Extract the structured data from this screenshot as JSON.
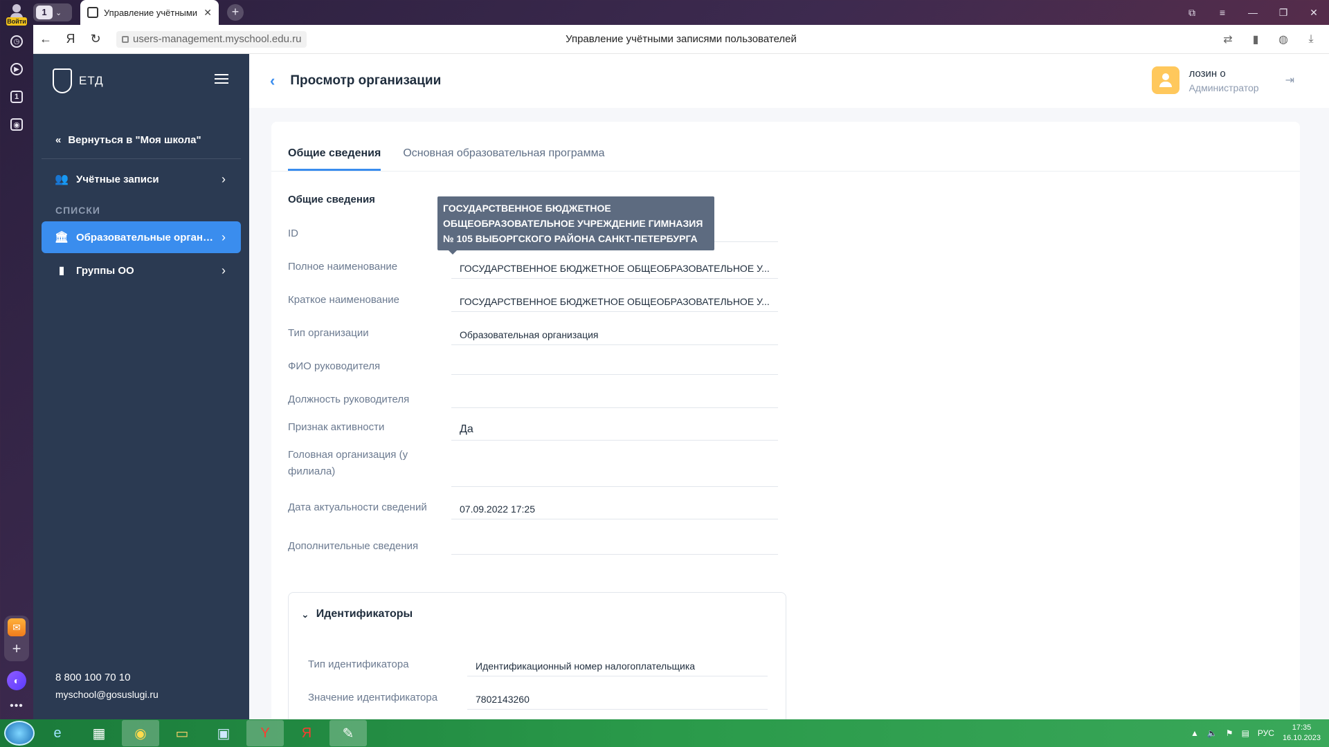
{
  "browser": {
    "tab_count": "1",
    "tab_title": "Управление учётными",
    "url": "users-management.myschool.edu.ru",
    "page_title": "Управление учётными записями пользователей",
    "login_badge": "Войти"
  },
  "sidebar": {
    "logo_text": "ЕТД",
    "back_label": "Вернуться в \"Моя школа\"",
    "items": [
      {
        "label": "Учётные записи"
      }
    ],
    "section_title": "СПИСКИ",
    "list_items": [
      {
        "label": "Образовательные организа..."
      },
      {
        "label": "Группы ОО"
      }
    ],
    "phone": "8 800 100 70 10",
    "email": "myschool@gosuslugi.ru"
  },
  "header": {
    "title": "Просмотр организации",
    "user_name": "лозин о",
    "user_role": "Администратор"
  },
  "tabs": [
    {
      "label": "Общие сведения"
    },
    {
      "label": "Основная образовательная программа"
    }
  ],
  "general": {
    "section_title": "Общие сведения",
    "tooltip": "ГОСУДАРСТВЕННОЕ БЮДЖЕТНОЕ ОБЩЕОБРАЗОВАТЕЛЬНОЕ УЧРЕЖДЕНИЕ ГИМНАЗИЯ № 105 ВЫБОРГСКОГО РАЙОНА САНКТ-ПЕТЕРБУРГА",
    "fields": [
      {
        "label": "ID",
        "value": ""
      },
      {
        "label": "Полное наименование",
        "value": "ГОСУДАРСТВЕННОЕ БЮДЖЕТНОЕ ОБЩЕОБРАЗОВАТЕЛЬНОЕ У..."
      },
      {
        "label": "Краткое наименование",
        "value": "ГОСУДАРСТВЕННОЕ БЮДЖЕТНОЕ ОБЩЕОБРАЗОВАТЕЛЬНОЕ У..."
      },
      {
        "label": "Тип организации",
        "value": "Образовательная организация"
      },
      {
        "label": "ФИО руководителя",
        "value": ""
      },
      {
        "label": "Должность руководителя",
        "value": ""
      },
      {
        "label": "Признак активности",
        "value": "Да"
      },
      {
        "label": "Головная организация (у филиала)",
        "value": ""
      },
      {
        "label": "Дата актуальности сведений",
        "value": "07.09.2022 17:25"
      },
      {
        "label": "Дополнительные сведения",
        "value": ""
      }
    ]
  },
  "identifiers": {
    "title": "Идентификаторы",
    "fields": [
      {
        "label": "Тип идентификатора",
        "value": "Идентификационный номер налогоплательщика"
      },
      {
        "label": "Значение идентификатора",
        "value": "7802143260"
      }
    ]
  },
  "taskbar": {
    "lang": "РУС",
    "time": "17:35",
    "date": "16.10.2023"
  }
}
